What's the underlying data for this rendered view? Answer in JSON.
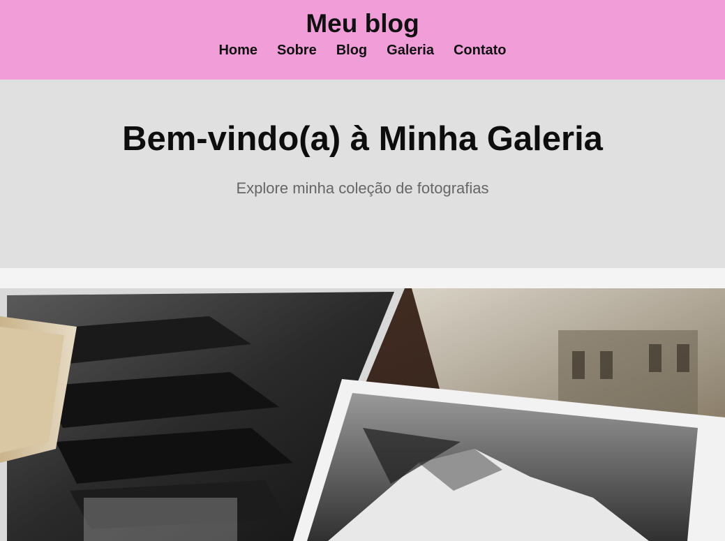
{
  "header": {
    "title": "Meu blog",
    "nav": [
      "Home",
      "Sobre",
      "Blog",
      "Galeria",
      "Contato"
    ],
    "background_color": "#f19ed8"
  },
  "hero": {
    "title": "Bem-vindo(a) à Minha Galeria",
    "subtitle": "Explore minha coleção de fotografias",
    "background_color": "#e0e0e0"
  },
  "gallery": {
    "image_subject": "vintage black-and-white photographs on a table"
  }
}
